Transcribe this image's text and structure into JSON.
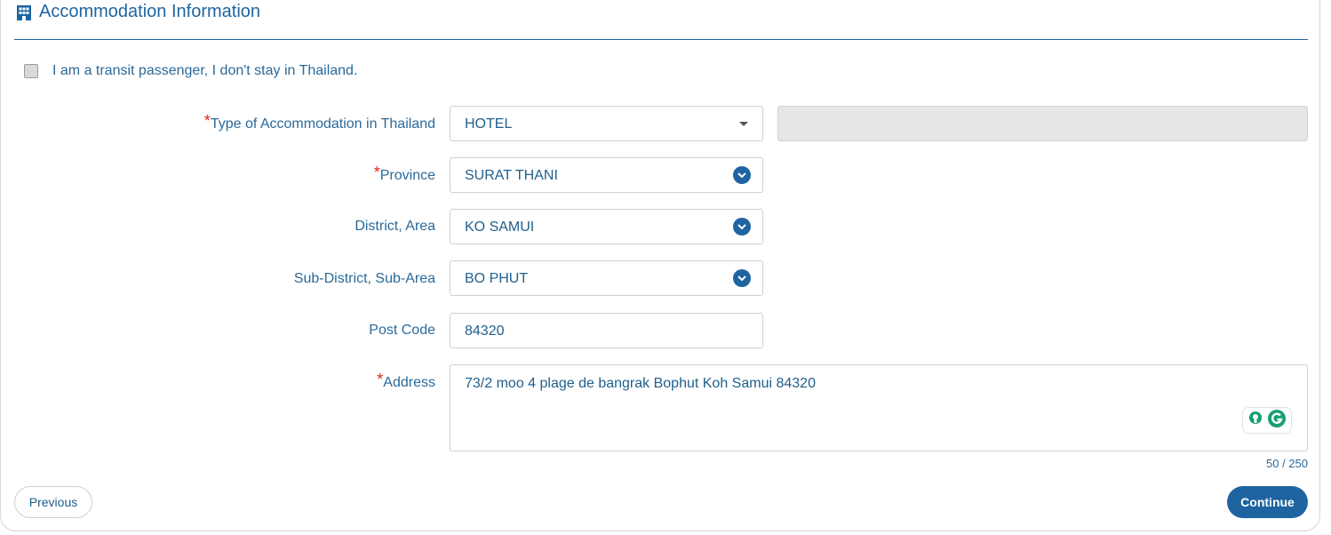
{
  "section": {
    "title": "Accommodation Information",
    "icon": "building-icon",
    "accent_color": "#1e64a0"
  },
  "transit": {
    "label": "I am a transit passenger, I don't stay in Thailand.",
    "checked": false
  },
  "fields": {
    "accommodation_type": {
      "label": "Type of Accommodation in Thailand",
      "required": "*",
      "value": "HOTEL"
    },
    "province": {
      "label": "Province",
      "required": "*",
      "value": "SURAT THANI"
    },
    "district": {
      "label": "District, Area",
      "value": "KO SAMUI"
    },
    "subdistrict": {
      "label": "Sub-District, Sub-Area",
      "value": "BO PHUT"
    },
    "postcode": {
      "label": "Post Code",
      "value": "84320"
    },
    "address": {
      "label": "Address",
      "required": "*",
      "value": "73/2 moo 4 plage de bangrak Bophut Koh Samui 84320",
      "counter": "50 / 250"
    }
  },
  "buttons": {
    "previous": "Previous",
    "continue": "Continue"
  }
}
